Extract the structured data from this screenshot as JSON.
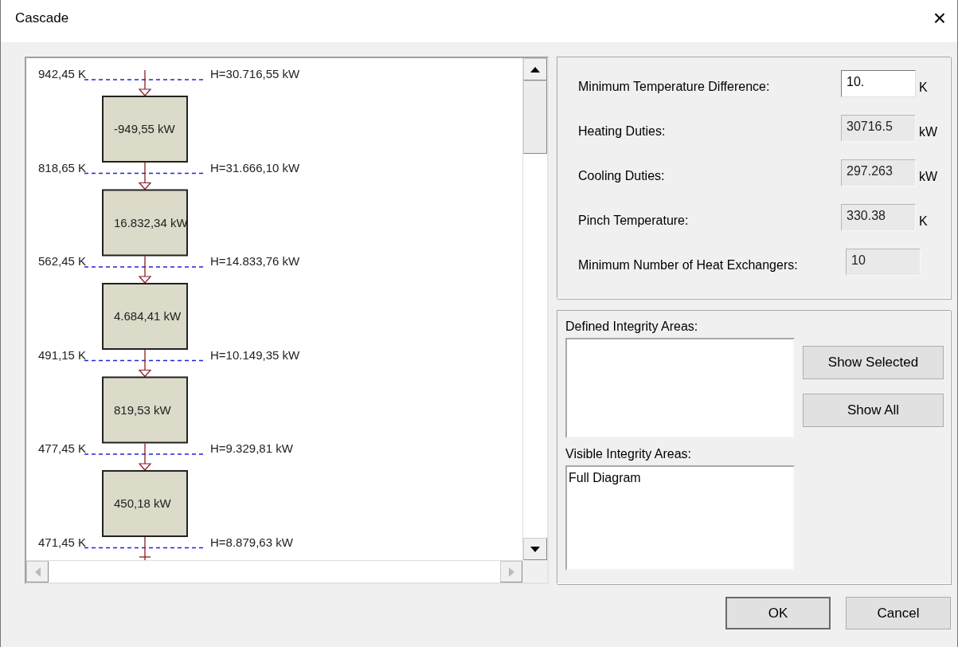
{
  "window": {
    "title": "Cascade",
    "close": "×"
  },
  "cascade": {
    "levels": [
      {
        "temperature": "942,45 K",
        "enthalpy": "H=30.716,55 kW"
      },
      {
        "temperature": "818,65 K",
        "enthalpy": "H=31.666,10 kW"
      },
      {
        "temperature": "562,45 K",
        "enthalpy": "H=14.833,76 kW"
      },
      {
        "temperature": "491,15 K",
        "enthalpy": "H=10.149,35 kW"
      },
      {
        "temperature": "477,45 K",
        "enthalpy": "H=9.329,81 kW"
      },
      {
        "temperature": "471,45 K",
        "enthalpy": "H=8.879,63 kW"
      }
    ],
    "intervals": [
      {
        "duty": "-949,55 kW"
      },
      {
        "duty": "16.832,34 kW"
      },
      {
        "duty": "4.684,41 kW"
      },
      {
        "duty": "819,53 kW"
      },
      {
        "duty": "450,18 kW"
      }
    ]
  },
  "results": [
    {
      "label": "Minimum Temperature Difference:",
      "value": "10.",
      "unit": "K",
      "readonly": false
    },
    {
      "label": "Heating Duties:",
      "value": "30716.5",
      "unit": "kW",
      "readonly": true
    },
    {
      "label": "Cooling Duties:",
      "value": "297.263",
      "unit": "kW",
      "readonly": true
    },
    {
      "label": "Pinch Temperature:",
      "value": "330.38",
      "unit": "K",
      "readonly": true
    },
    {
      "label": "Minimum Number of Heat Exchangers:",
      "value": "10",
      "readonly": true
    }
  ],
  "integrity": {
    "defined_label": "Defined Integrity Areas:",
    "visible_label": "Visible Integrity Areas:",
    "visible_items": [
      "Full Diagram"
    ],
    "buttons": [
      "Show Selected",
      "Show All"
    ]
  },
  "footer_buttons": [
    {
      "label": "OK",
      "default": true
    },
    {
      "label": "Cancel",
      "default": false
    }
  ]
}
